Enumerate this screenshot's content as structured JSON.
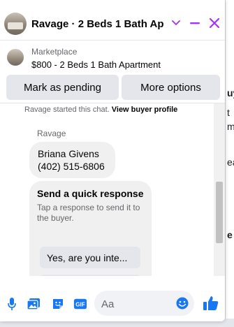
{
  "colors": {
    "accent": "#1877f2",
    "purple": "#a033ff",
    "button_bg": "#e4e6eb",
    "bubble_bg": "#f0f0f0"
  },
  "header": {
    "title": "Ravage · 2 Beds 1 Bath Ap...",
    "icons": [
      "chevron-down-icon",
      "minimize-icon",
      "close-icon"
    ]
  },
  "listing": {
    "source": "Marketplace",
    "title": "$800 - 2 Beds 1 Bath Apartment"
  },
  "actions": {
    "mark_pending": "Mark as pending",
    "more_options": "More options"
  },
  "thread": {
    "started_text": "Ravage started this chat.",
    "view_profile": "View buyer profile",
    "sender": "Ravage",
    "message_lines": [
      "Briana Givens",
      "(402) 515-6806"
    ],
    "quick_title": "Send a quick response",
    "quick_desc": "Tap a response to send it to the buyer.",
    "quick_replies": [
      "Yes, are you inte...",
      ""
    ]
  },
  "composer": {
    "placeholder": "Aa",
    "icons": [
      "microphone-icon",
      "photo-icon",
      "sticker-icon",
      "gif-icon",
      "emoji-icon",
      "like-icon"
    ],
    "gif_label": "GIF"
  },
  "background": {
    "texts": [
      "uy",
      "t",
      "m",
      "ea",
      "e"
    ]
  }
}
